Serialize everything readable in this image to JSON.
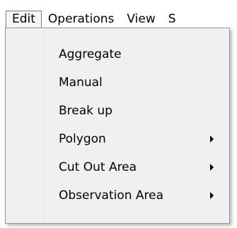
{
  "menubar": {
    "items": [
      {
        "label": "Edit"
      },
      {
        "label": "Operations"
      },
      {
        "label": "View"
      },
      {
        "label": "S"
      }
    ]
  },
  "menu": {
    "items": [
      {
        "label": "Aggregate",
        "submenu": false
      },
      {
        "label": "Manual",
        "submenu": false
      },
      {
        "label": "Break up",
        "submenu": false
      },
      {
        "label": "Polygon",
        "submenu": true
      },
      {
        "label": "Cut Out Area",
        "submenu": true
      },
      {
        "label": "Observation Area",
        "submenu": true
      }
    ]
  },
  "icons": {
    "submenu_arrow": "chevron-right-icon"
  }
}
